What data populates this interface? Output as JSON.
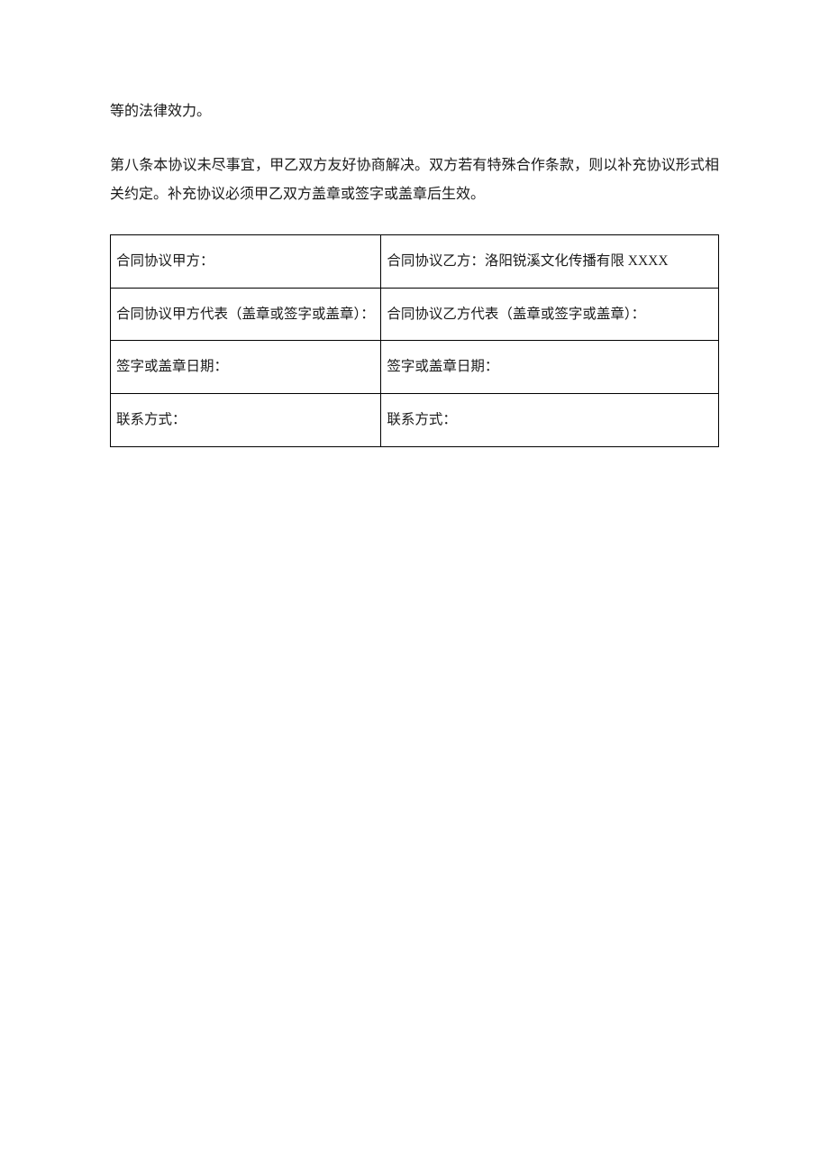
{
  "paragraphs": {
    "p1": "等的法律效力。",
    "p2": "第八条本协议未尽事宜，甲乙双方友好协商解决。双方若有特殊合作条款，则以补充协议形式相关约定。补充协议必须甲乙双方盖章或签字或盖章后生效。"
  },
  "table": {
    "rows": [
      {
        "left": "合同协议甲方：",
        "right": "合同协议乙方：洛阳锐溪文化传播有限 XXXX"
      },
      {
        "left": "合同协议甲方代表（盖章或签字或盖章）：",
        "right": "合同协议乙方代表（盖章或签字或盖章）："
      },
      {
        "left": "签字或盖章日期：",
        "right": "签字或盖章日期："
      },
      {
        "left": "联系方式：",
        "right": "联系方式："
      }
    ]
  }
}
